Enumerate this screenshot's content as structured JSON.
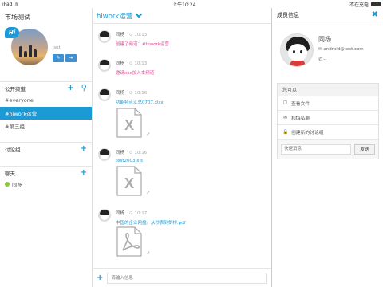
{
  "statusbar": {
    "device": "iPad",
    "wifi": "≋",
    "time": "上午10:24",
    "battery_text": "不在充电"
  },
  "sidebar": {
    "title": "市场测试",
    "profile": {
      "badge": "Hi",
      "name": "test",
      "edit_icon": "✎",
      "logout_icon": "⇥"
    },
    "public_channels": {
      "header": "公开频道",
      "add": "+",
      "search": "⚲",
      "items": [
        "#everyone",
        "#hiwork运营",
        "#第三组"
      ],
      "active_index": 1
    },
    "discussion": {
      "header": "讨论组",
      "add": "+"
    },
    "chat": {
      "header": "聊天",
      "add": "+",
      "users": [
        "同杨"
      ]
    }
  },
  "chat": {
    "title": "hiwork运营",
    "messages": [
      {
        "sender": "同杨",
        "time": "10:13",
        "text": "创建了频道：#hiwork运营",
        "color": "pink"
      },
      {
        "sender": "同杨",
        "time": "10:13",
        "text": "邀请xxx加入本频道",
        "color": "pink"
      },
      {
        "sender": "同杨",
        "time": "10:16",
        "text": "功能特点汇总0707.xlsx",
        "color": "blue",
        "file": "x"
      },
      {
        "sender": "同杨",
        "time": "10:16",
        "text": "test2003.xls",
        "color": "blue",
        "file": "x"
      },
      {
        "sender": "同杨",
        "time": "10:17",
        "text": "中国的企业网盘。从秒表到剑桥.pdf",
        "color": "blue",
        "file": "pdf"
      }
    ],
    "input_placeholder": "请输入信息",
    "add": "+",
    "share_icon": "↗"
  },
  "member": {
    "header": "成员信息",
    "close": "✖",
    "name": "同杨",
    "email": "android@test.com",
    "phone": "--",
    "actions_title": "您可以",
    "actions": [
      {
        "icon": "☐",
        "label": "查看文件"
      },
      {
        "icon": "✉",
        "label": "和ta私聊"
      },
      {
        "icon": "🔒",
        "label": "创建新的讨论组"
      }
    ],
    "quick_placeholder": "快速消息",
    "send": "发送"
  },
  "colors": {
    "accent": "#1b9ad6",
    "pink": "#e44d9a",
    "online": "#8cc63f"
  }
}
